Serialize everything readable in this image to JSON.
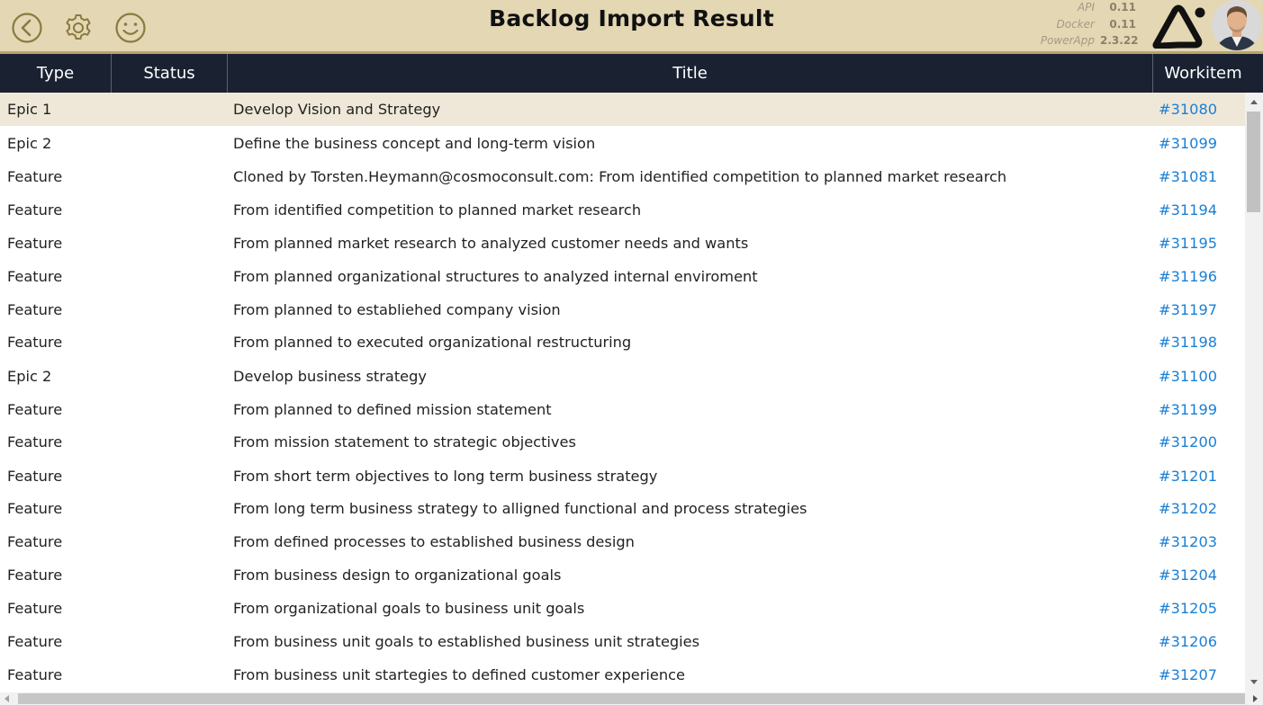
{
  "app": {
    "title": "Backlog Import Result"
  },
  "header": {
    "icons": {
      "back": "chevron-left-circle-icon",
      "settings": "gear-icon",
      "feedback": "smiley-icon"
    },
    "versions": [
      {
        "label": "API",
        "value": "0.11"
      },
      {
        "label": "Docker",
        "value": "0.11"
      },
      {
        "label": "PowerApp",
        "value": "2.3.22"
      }
    ]
  },
  "colors": {
    "header_bg": "#e3d7b4",
    "header_border": "#b8a46a",
    "table_header_bg": "#1a2232",
    "selected_row_bg": "#efe8d8",
    "link": "#1a7fd4",
    "icon": "#8a7a3e"
  },
  "table": {
    "columns": [
      "Type",
      "Status",
      "Title",
      "Workitem"
    ],
    "rows": [
      {
        "type": "Epic 1",
        "status": "",
        "title": "Develop Vision and Strategy",
        "workitem": "#31080",
        "selected": true
      },
      {
        "type": "Epic 2",
        "status": "",
        "title": "Define the business concept and long-term vision",
        "workitem": "#31099"
      },
      {
        "type": "Feature",
        "status": "",
        "title": "Cloned by Torsten.Heymann@cosmoconsult.com: From identified competition to planned market research",
        "workitem": "#31081"
      },
      {
        "type": "Feature",
        "status": "",
        "title": "From identified competition to planned market research",
        "workitem": "#31194"
      },
      {
        "type": "Feature",
        "status": "",
        "title": "From planned market research to analyzed customer needs and wants",
        "workitem": "#31195"
      },
      {
        "type": "Feature",
        "status": "",
        "title": "From planned organizational structures to analyzed internal enviroment",
        "workitem": "#31196"
      },
      {
        "type": "Feature",
        "status": "",
        "title": "From planned to establiehed company vision",
        "workitem": "#31197"
      },
      {
        "type": "Feature",
        "status": "",
        "title": "From planned to executed organizational restructuring",
        "workitem": "#31198"
      },
      {
        "type": "Epic 2",
        "status": "",
        "title": "Develop business strategy",
        "workitem": "#31100"
      },
      {
        "type": "Feature",
        "status": "",
        "title": "From planned to defined mission statement",
        "workitem": "#31199"
      },
      {
        "type": "Feature",
        "status": "",
        "title": "From mission statement to strategic objectives",
        "workitem": "#31200"
      },
      {
        "type": "Feature",
        "status": "",
        "title": "From short term objectives to long term business strategy",
        "workitem": "#31201"
      },
      {
        "type": "Feature",
        "status": "",
        "title": "From long term business strategy to alligned functional and process strategies",
        "workitem": "#31202"
      },
      {
        "type": "Feature",
        "status": "",
        "title": "From defined processes to established business design",
        "workitem": "#31203"
      },
      {
        "type": "Feature",
        "status": "",
        "title": "From business design to organizational goals",
        "workitem": "#31204"
      },
      {
        "type": "Feature",
        "status": "",
        "title": "From organizational goals to business unit goals",
        "workitem": "#31205"
      },
      {
        "type": "Feature",
        "status": "",
        "title": "From business unit goals to established business unit strategies",
        "workitem": "#31206"
      },
      {
        "type": "Feature",
        "status": "",
        "title": "From business unit startegies to defined customer experience",
        "workitem": "#31207"
      }
    ]
  }
}
